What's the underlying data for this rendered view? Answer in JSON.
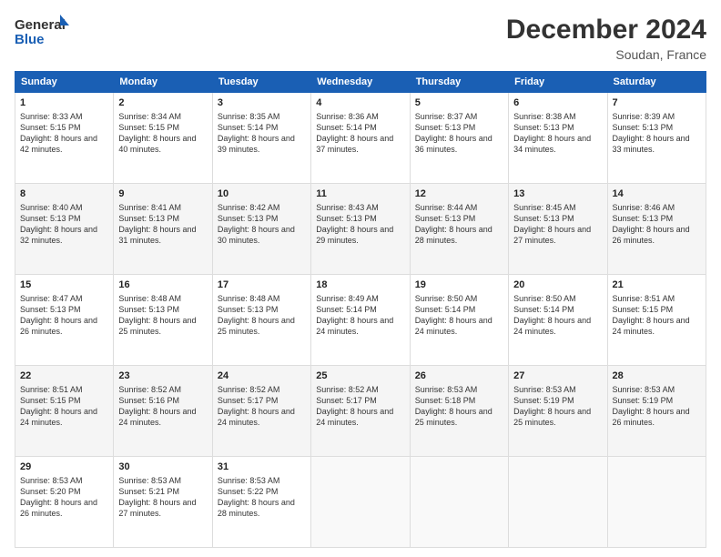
{
  "logo": {
    "line1": "General",
    "line2": "Blue"
  },
  "title": "December 2024",
  "subtitle": "Soudan, France",
  "days_header": [
    "Sunday",
    "Monday",
    "Tuesday",
    "Wednesday",
    "Thursday",
    "Friday",
    "Saturday"
  ],
  "weeks": [
    [
      {
        "day": "1",
        "sunrise": "8:33 AM",
        "sunset": "5:15 PM",
        "daylight": "8 hours and 42 minutes."
      },
      {
        "day": "2",
        "sunrise": "8:34 AM",
        "sunset": "5:15 PM",
        "daylight": "8 hours and 40 minutes."
      },
      {
        "day": "3",
        "sunrise": "8:35 AM",
        "sunset": "5:14 PM",
        "daylight": "8 hours and 39 minutes."
      },
      {
        "day": "4",
        "sunrise": "8:36 AM",
        "sunset": "5:14 PM",
        "daylight": "8 hours and 37 minutes."
      },
      {
        "day": "5",
        "sunrise": "8:37 AM",
        "sunset": "5:13 PM",
        "daylight": "8 hours and 36 minutes."
      },
      {
        "day": "6",
        "sunrise": "8:38 AM",
        "sunset": "5:13 PM",
        "daylight": "8 hours and 34 minutes."
      },
      {
        "day": "7",
        "sunrise": "8:39 AM",
        "sunset": "5:13 PM",
        "daylight": "8 hours and 33 minutes."
      }
    ],
    [
      {
        "day": "8",
        "sunrise": "8:40 AM",
        "sunset": "5:13 PM",
        "daylight": "8 hours and 32 minutes."
      },
      {
        "day": "9",
        "sunrise": "8:41 AM",
        "sunset": "5:13 PM",
        "daylight": "8 hours and 31 minutes."
      },
      {
        "day": "10",
        "sunrise": "8:42 AM",
        "sunset": "5:13 PM",
        "daylight": "8 hours and 30 minutes."
      },
      {
        "day": "11",
        "sunrise": "8:43 AM",
        "sunset": "5:13 PM",
        "daylight": "8 hours and 29 minutes."
      },
      {
        "day": "12",
        "sunrise": "8:44 AM",
        "sunset": "5:13 PM",
        "daylight": "8 hours and 28 minutes."
      },
      {
        "day": "13",
        "sunrise": "8:45 AM",
        "sunset": "5:13 PM",
        "daylight": "8 hours and 27 minutes."
      },
      {
        "day": "14",
        "sunrise": "8:46 AM",
        "sunset": "5:13 PM",
        "daylight": "8 hours and 26 minutes."
      }
    ],
    [
      {
        "day": "15",
        "sunrise": "8:47 AM",
        "sunset": "5:13 PM",
        "daylight": "8 hours and 26 minutes."
      },
      {
        "day": "16",
        "sunrise": "8:48 AM",
        "sunset": "5:13 PM",
        "daylight": "8 hours and 25 minutes."
      },
      {
        "day": "17",
        "sunrise": "8:48 AM",
        "sunset": "5:13 PM",
        "daylight": "8 hours and 25 minutes."
      },
      {
        "day": "18",
        "sunrise": "8:49 AM",
        "sunset": "5:14 PM",
        "daylight": "8 hours and 24 minutes."
      },
      {
        "day": "19",
        "sunrise": "8:50 AM",
        "sunset": "5:14 PM",
        "daylight": "8 hours and 24 minutes."
      },
      {
        "day": "20",
        "sunrise": "8:50 AM",
        "sunset": "5:14 PM",
        "daylight": "8 hours and 24 minutes."
      },
      {
        "day": "21",
        "sunrise": "8:51 AM",
        "sunset": "5:15 PM",
        "daylight": "8 hours and 24 minutes."
      }
    ],
    [
      {
        "day": "22",
        "sunrise": "8:51 AM",
        "sunset": "5:15 PM",
        "daylight": "8 hours and 24 minutes."
      },
      {
        "day": "23",
        "sunrise": "8:52 AM",
        "sunset": "5:16 PM",
        "daylight": "8 hours and 24 minutes."
      },
      {
        "day": "24",
        "sunrise": "8:52 AM",
        "sunset": "5:17 PM",
        "daylight": "8 hours and 24 minutes."
      },
      {
        "day": "25",
        "sunrise": "8:52 AM",
        "sunset": "5:17 PM",
        "daylight": "8 hours and 24 minutes."
      },
      {
        "day": "26",
        "sunrise": "8:53 AM",
        "sunset": "5:18 PM",
        "daylight": "8 hours and 25 minutes."
      },
      {
        "day": "27",
        "sunrise": "8:53 AM",
        "sunset": "5:19 PM",
        "daylight": "8 hours and 25 minutes."
      },
      {
        "day": "28",
        "sunrise": "8:53 AM",
        "sunset": "5:19 PM",
        "daylight": "8 hours and 26 minutes."
      }
    ],
    [
      {
        "day": "29",
        "sunrise": "8:53 AM",
        "sunset": "5:20 PM",
        "daylight": "8 hours and 26 minutes."
      },
      {
        "day": "30",
        "sunrise": "8:53 AM",
        "sunset": "5:21 PM",
        "daylight": "8 hours and 27 minutes."
      },
      {
        "day": "31",
        "sunrise": "8:53 AM",
        "sunset": "5:22 PM",
        "daylight": "8 hours and 28 minutes."
      },
      null,
      null,
      null,
      null
    ]
  ],
  "labels": {
    "sunrise": "Sunrise:",
    "sunset": "Sunset:",
    "daylight": "Daylight:"
  }
}
